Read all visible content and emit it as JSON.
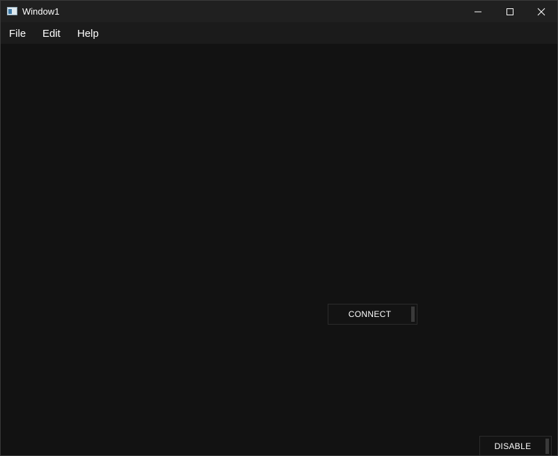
{
  "window": {
    "title": "Window1",
    "icon": "app-window-icon"
  },
  "titlebar": {
    "minimize_icon": "minimize-icon",
    "maximize_icon": "maximize-icon",
    "close_icon": "close-icon"
  },
  "menubar": {
    "items": [
      {
        "label": "File"
      },
      {
        "label": "Edit"
      },
      {
        "label": "Help"
      }
    ]
  },
  "main": {
    "connect_label": "CONNECT",
    "disable_label": "DISABLE"
  },
  "colors": {
    "background": "#121212",
    "titlebar": "#202020",
    "menubar": "#1b1b1b",
    "text": "#ffffff"
  }
}
